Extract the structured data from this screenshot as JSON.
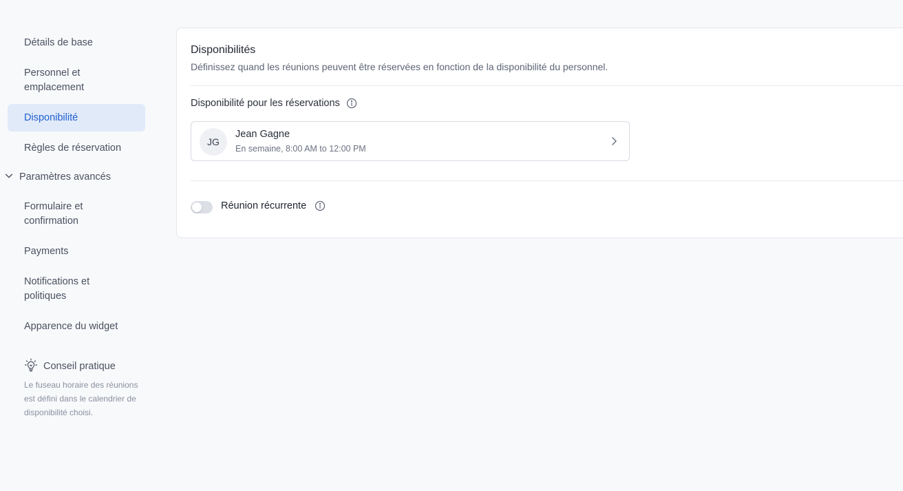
{
  "sidebar": {
    "items": [
      {
        "label": "Détails de base"
      },
      {
        "label": "Personnel et emplacement"
      },
      {
        "label": "Disponibilité",
        "active": true
      },
      {
        "label": "Règles de réservation"
      }
    ],
    "group": {
      "label": "Paramètres avancés",
      "icon": "chevron-down-icon",
      "items": [
        {
          "label": "Formulaire et confirmation"
        },
        {
          "label": "Payments"
        },
        {
          "label": "Notifications et politiques"
        },
        {
          "label": "Apparence du widget"
        }
      ]
    },
    "tip": {
      "icon": "lightbulb-icon",
      "title": "Conseil pratique",
      "text": "Le fuseau horaire des réunions est défini dans le calendrier de disponibilité choisi."
    }
  },
  "main": {
    "title": "Disponibilités",
    "subtitle": "Définissez quand les réunions peuvent être réservées en fonction de la disponibilité du personnel.",
    "availability_label": "Disponibilité pour les réservations",
    "staff": {
      "initials": "JG",
      "name": "Jean Gagne",
      "hours": "En semaine, 8:00 AM to 12:00 PM"
    },
    "recurring": {
      "label": "Réunion récurrente",
      "enabled": false
    }
  },
  "colors": {
    "accent": "#1f5fcf",
    "active_bg": "#e1eaf9",
    "page_bg": "#f8f9fb"
  }
}
